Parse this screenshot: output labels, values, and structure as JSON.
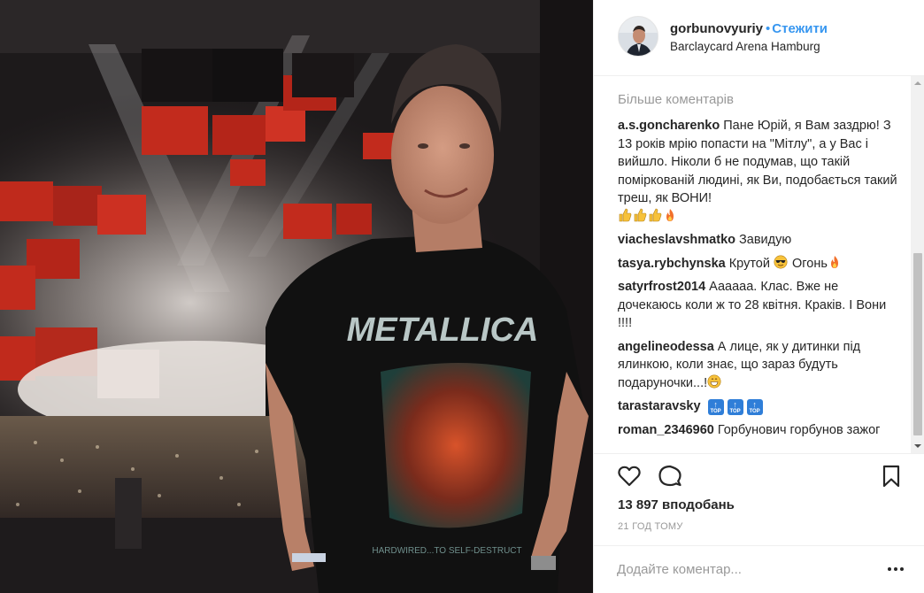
{
  "post": {
    "username": "gorbunovyuriy",
    "dot": "•",
    "follow_label": "Стежити",
    "location": "Barclaycard Arena Hamburg",
    "shirt_text": "METALLICA",
    "shirt_subtext": "HARDWIRED...TO SELF-DESTRUCT"
  },
  "comments_section": {
    "load_more": "Більше коментарів",
    "comments": [
      {
        "user": "a.s.goncharenko",
        "text": "Пане Юрій, я Вам заздрю! З 13 років мрію попасти на \"Мітлу\", а у Вас і вийшло. Ніколи б не подумав, що такій поміркованій людині, як Ви, подобається такий треш, як ВОНИ!",
        "emojis": [
          "thumbs-up",
          "thumbs-up",
          "thumbs-up",
          "fire"
        ]
      },
      {
        "user": "viacheslavshmatko",
        "text": "Завидую"
      },
      {
        "user": "tasya.rybchynska",
        "text": "Крутой",
        "text2": "Огонь"
      },
      {
        "user": "satyrfrost2014",
        "text": "Аааааа. Клас. Вже не дочекаюсь коли ж то 28 квітня. Краків. І Вони !!!!"
      },
      {
        "user": "angelineodessa",
        "text": "А лице, як у дитинки під ялинкою, коли знає, що зараз будуть подаруночки...!"
      },
      {
        "user": "tarastaravsky",
        "badge_label": "TOP"
      },
      {
        "user": "roman_2346960",
        "text": "Горбунович горбунов зажог"
      }
    ]
  },
  "actions": {
    "likes": "13 897 вподобань",
    "time": "21 год тому",
    "like_icon": "heart-icon",
    "comment_icon": "speech-bubble-icon",
    "save_icon": "bookmark-icon"
  },
  "add_comment": {
    "placeholder": "Додайте коментар...",
    "more_icon": "more-options-icon"
  },
  "colors": {
    "accent": "#3897f0",
    "muted": "#999999",
    "border": "#efefef",
    "text": "#262626"
  }
}
